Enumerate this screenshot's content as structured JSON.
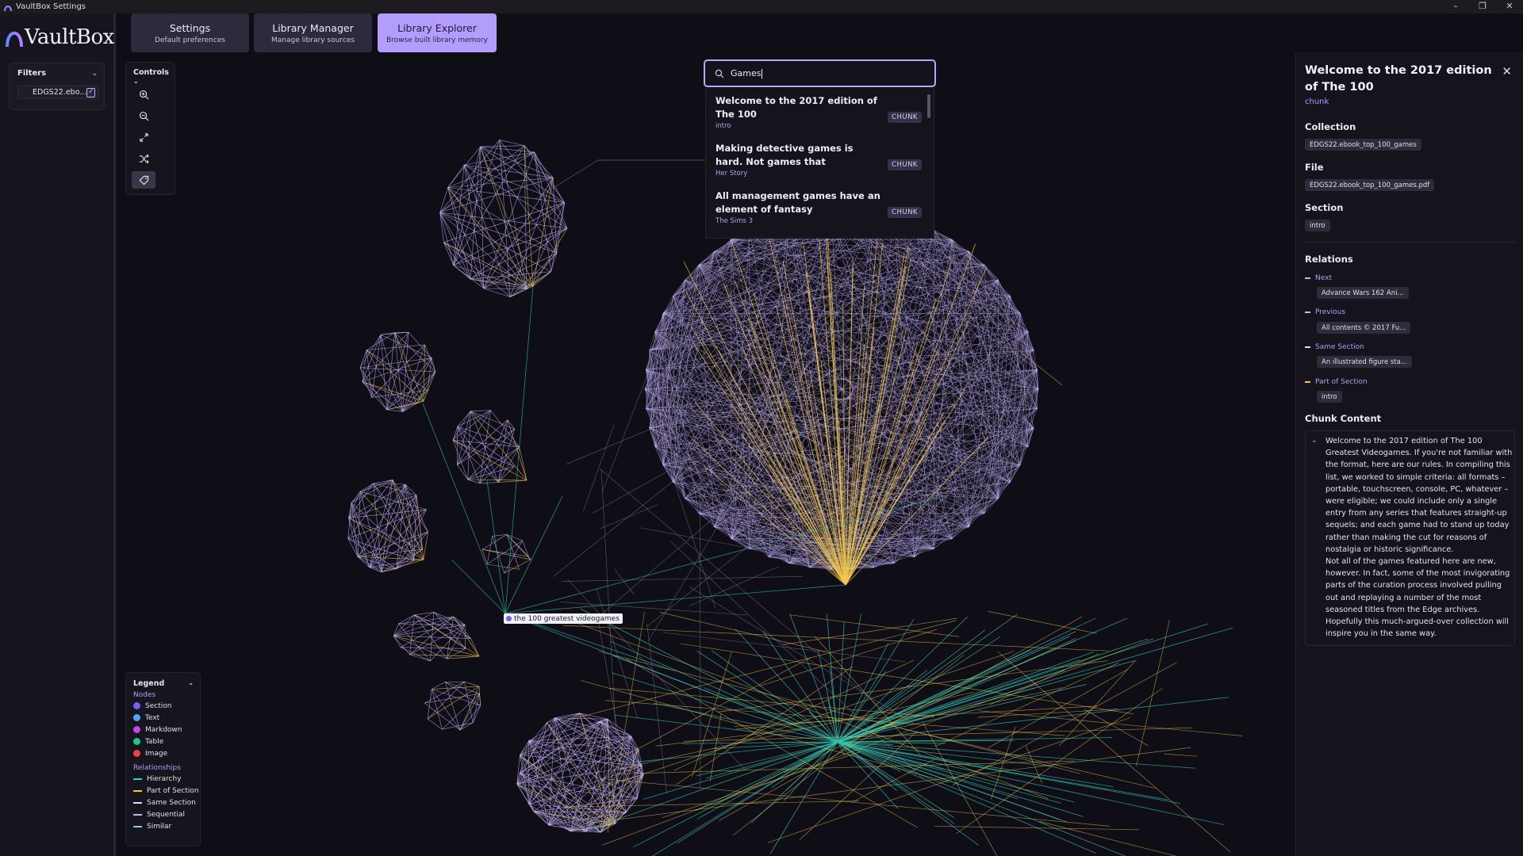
{
  "window": {
    "title": "VaultBox Settings",
    "controls": [
      "–",
      "❐",
      "✕"
    ]
  },
  "logo": {
    "text": "VaultBox"
  },
  "nav": {
    "tabs": [
      {
        "label": "Settings",
        "sublabel": "Default preferences"
      },
      {
        "label": "Library Manager",
        "sublabel": "Manage library sources"
      },
      {
        "label": "Library Explorer",
        "sublabel": "Browse built library memory",
        "active": true
      }
    ]
  },
  "filters": {
    "title": "Filters",
    "items": [
      {
        "label": "EDGS22.ebo...",
        "checked": true
      }
    ]
  },
  "controls": {
    "title": "Controls",
    "buttons": [
      "zoom-in-icon",
      "zoom-out-icon",
      "fit-view-icon",
      "shuffle-icon",
      "label-tag-icon"
    ]
  },
  "search": {
    "value": "Games",
    "results": [
      {
        "title": "Welcome to the 2017 edition of The 100",
        "sub": "intro",
        "badge": "CHUNK"
      },
      {
        "title": "Making detective games is hard. Not games that",
        "sub": "Her Story",
        "badge": "CHUNK"
      },
      {
        "title": "All management games have an element of fantasy",
        "sub": "The Sims 3",
        "badge": "CHUNK"
      }
    ]
  },
  "graph": {
    "hover_label": "the 100 greatest videogames"
  },
  "legend": {
    "title": "Legend",
    "nodes_title": "Nodes",
    "nodes": [
      {
        "label": "Section",
        "color": "#7c5cff"
      },
      {
        "label": "Text",
        "color": "#4ea3ff"
      },
      {
        "label": "Markdown",
        "color": "#c246e6"
      },
      {
        "label": "Table",
        "color": "#1fc78f"
      },
      {
        "label": "Image",
        "color": "#f0413f"
      }
    ],
    "rel_title": "Relationships",
    "relationships": [
      {
        "label": "Hierarchy",
        "color": "#2dd4bf"
      },
      {
        "label": "Part of Section",
        "color": "#facc15"
      },
      {
        "label": "Same Section",
        "color": "#e9d5ff"
      },
      {
        "label": "Sequential",
        "color": "#c4b5fd"
      },
      {
        "label": "Similar",
        "color": "#93c5fd"
      }
    ]
  },
  "details": {
    "title": "Welcome to the 2017 edition of The 100",
    "kind": "chunk",
    "collection_label": "Collection",
    "collection": "EDGS22.ebook_top_100_games",
    "file_label": "File",
    "file": "EDGS22.ebook_top_100_games.pdf",
    "section_label": "Section",
    "section": "intro",
    "relations_label": "Relations",
    "relations": [
      {
        "label": "Next",
        "value": "Advance Wars 162 Ani...",
        "color": "#c4b5fd"
      },
      {
        "label": "Previous",
        "value": "All contents © 2017 Fu...",
        "color": "#c4b5fd"
      },
      {
        "label": "Same Section",
        "value": "An illustrated figure sta...",
        "color": "#e9d5ff"
      },
      {
        "label": "Part of Section",
        "value": "intro",
        "color": "#facc15"
      }
    ],
    "content_label": "Chunk Content",
    "content": "Welcome to the 2017 edition of The 100 Greatest Videogames. If you're not familiar with the format, here are our rules. In compiling this list, we worked to simple criteria: all formats – portable, touchscreen, console, PC, whatever – were eligible; we could include only a single entry from any series that features straight-up sequels; and each game had to stand up today rather than making the cut for reasons of nostalgia or historic significance.\nNot all of the games featured here are new, however. In fact, some of the most invigorating parts of the curation process involved pulling out and replaying a number of the most seasoned titles from the Edge archives. Hopefully this much-argued-over collection will inspire you in the same way."
  }
}
